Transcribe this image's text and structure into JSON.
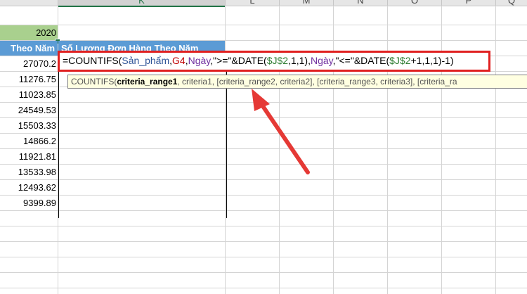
{
  "columns": {
    "k": "K",
    "l": "L",
    "m": "M",
    "n": "N",
    "o": "O",
    "p": "P",
    "q": "Q"
  },
  "year_cell": "2020",
  "headers": {
    "left": "Theo Năm",
    "right": "Số Lượng Đơn Hàng Theo Năm"
  },
  "values": [
    "27070.2",
    "11276.75",
    "11023.85",
    "24549.53",
    "15503.33",
    "14866.2",
    "11921.81",
    "13533.98",
    "12493.62",
    "9399.89"
  ],
  "formula": {
    "eq": "=COUNTIFS(",
    "arg1": "Sản_phẩm",
    "c1": ",",
    "arg2": "G4",
    "c2": ",",
    "arg3": "Ngày",
    "s1": ",\">=\"&DATE(",
    "ref1": "$J$2",
    "s2": ",1,1),",
    "arg4": "Ngày",
    "s3": ",\"<=\"&DATE(",
    "ref2": "$J$2",
    "s4": "+1,1,1)-1)"
  },
  "tooltip": {
    "fn": "COUNTIFS(",
    "bold": "criteria_range1",
    "rest": ", criteria1, [criteria_range2, criteria2], [criteria_range3, criteria3], [criteria_ra"
  },
  "colors": {
    "highlight_box": "#e02020",
    "arrow": "#e53935",
    "header_bg": "#5b9bd5",
    "year_bg": "#a9d08e"
  }
}
